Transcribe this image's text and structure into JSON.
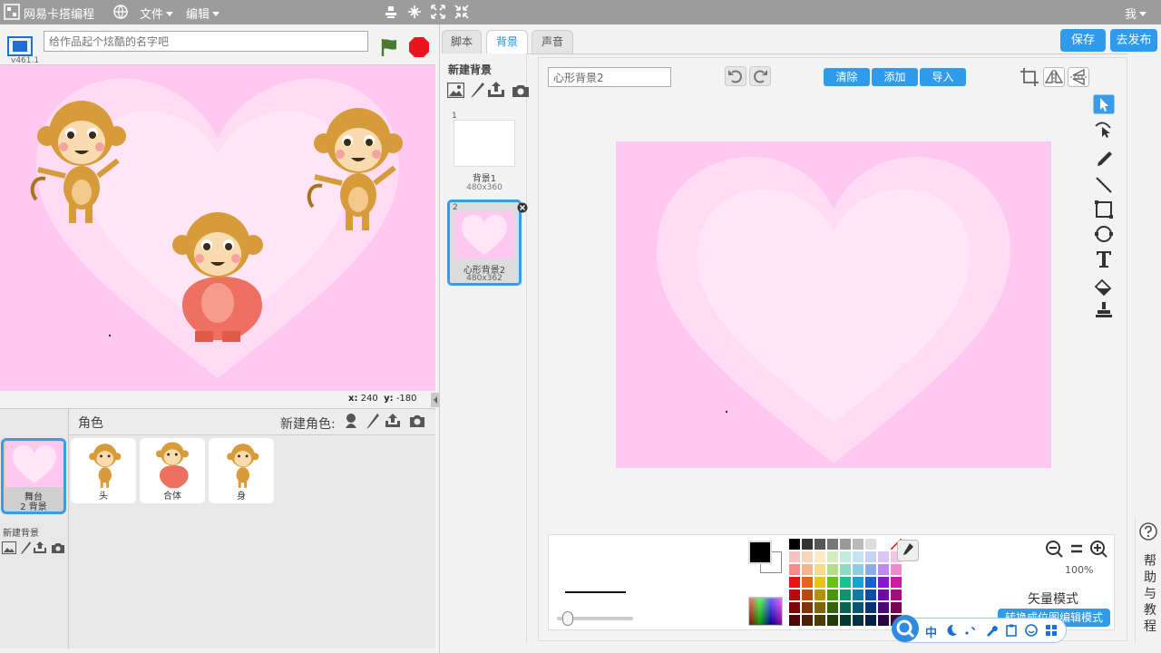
{
  "topbar": {
    "app_name": "网易卡搭编程",
    "menu_file": "文件",
    "menu_edit": "编辑",
    "user": "我"
  },
  "header": {
    "version": "v461.1",
    "title_placeholder": "给作品起个炫酷的名字吧"
  },
  "stage": {
    "coord_x_label": "x:",
    "coord_x": "240",
    "coord_y_label": "y:",
    "coord_y": "-180"
  },
  "sprites": {
    "section_label": "角色",
    "new_sprite_label": "新建角色:",
    "stage_tile": {
      "name": "舞台",
      "sub": "2 背景"
    },
    "items": [
      {
        "name": "头"
      },
      {
        "name": "合体"
      },
      {
        "name": "身"
      }
    ],
    "new_backdrop_label": "新建背景"
  },
  "tabs": [
    {
      "label": "脚本"
    },
    {
      "label": "背景"
    },
    {
      "label": "声音"
    }
  ],
  "actions": {
    "save": "保存",
    "publish": "去发布"
  },
  "backdrops": {
    "new_label": "新建背景",
    "items": [
      {
        "index": "1",
        "name": "背景1",
        "size": "480x360"
      },
      {
        "index": "2",
        "name": "心形背景2",
        "size": "480x362"
      }
    ]
  },
  "paint": {
    "name_value": "心形背景2",
    "btn_clear": "清除",
    "btn_add": "添加",
    "btn_import": "导入",
    "zoom": "100%",
    "mode": "矢量模式",
    "convert_btn": "转换成位图编辑模式"
  },
  "ime": {
    "lang": "中"
  },
  "help": {
    "label_chars": [
      "帮",
      "助",
      "与",
      "教",
      "程"
    ]
  },
  "colors": {
    "accent": "#2f9bea",
    "stage_pink": "#ffc8f0",
    "topbar": "#9c9c9c"
  }
}
